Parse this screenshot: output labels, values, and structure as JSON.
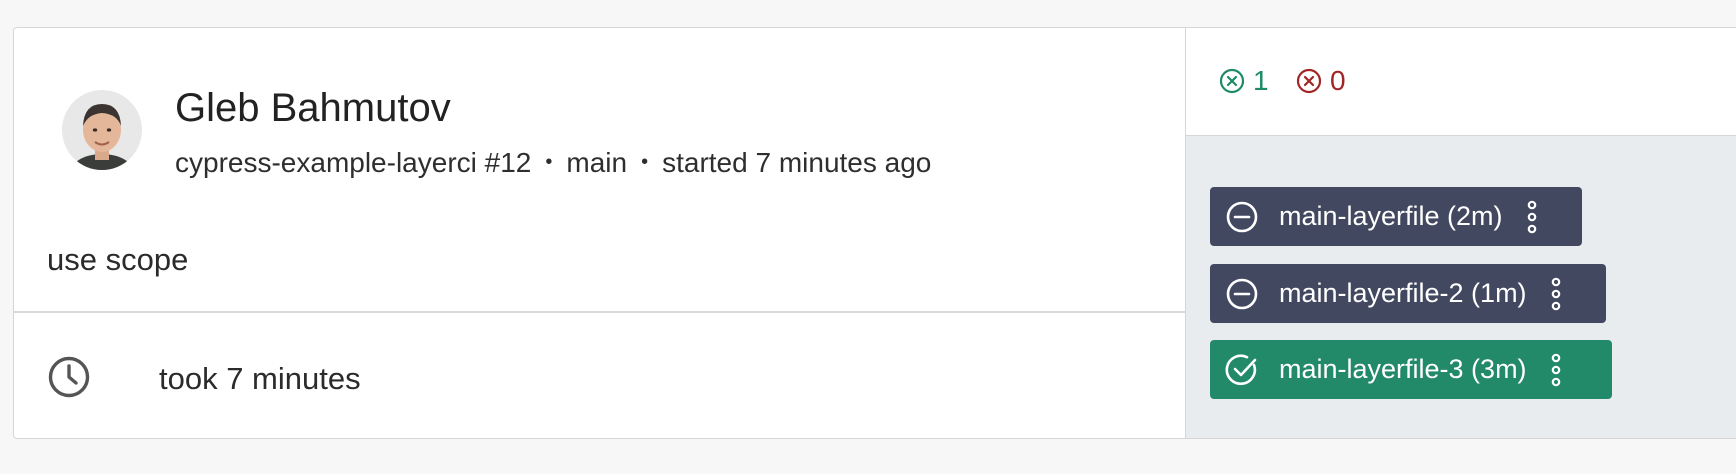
{
  "author": {
    "name": "Gleb Bahmutov",
    "avatar_alt": "Gleb Bahmutov"
  },
  "run": {
    "project": "cypress-example-layerci #12",
    "branch": "main",
    "started": "started 7 minutes ago",
    "separator": "•",
    "message": "use scope",
    "duration": "took 7 minutes"
  },
  "stats": {
    "passed": "1",
    "failed": "0"
  },
  "groups": [
    {
      "label": "main-layerfile (2m)",
      "status": "cancelled",
      "icon": "minus-circle-icon"
    },
    {
      "label": "main-layerfile-2 (1m)",
      "status": "cancelled",
      "icon": "minus-circle-icon"
    },
    {
      "label": "main-layerfile-3 (3m)",
      "status": "passed",
      "icon": "check-circle-icon"
    }
  ],
  "colors": {
    "pass": "#1f8a68",
    "fail": "#a12525",
    "chip_dark": "#434861",
    "chip_green": "#228a68"
  }
}
